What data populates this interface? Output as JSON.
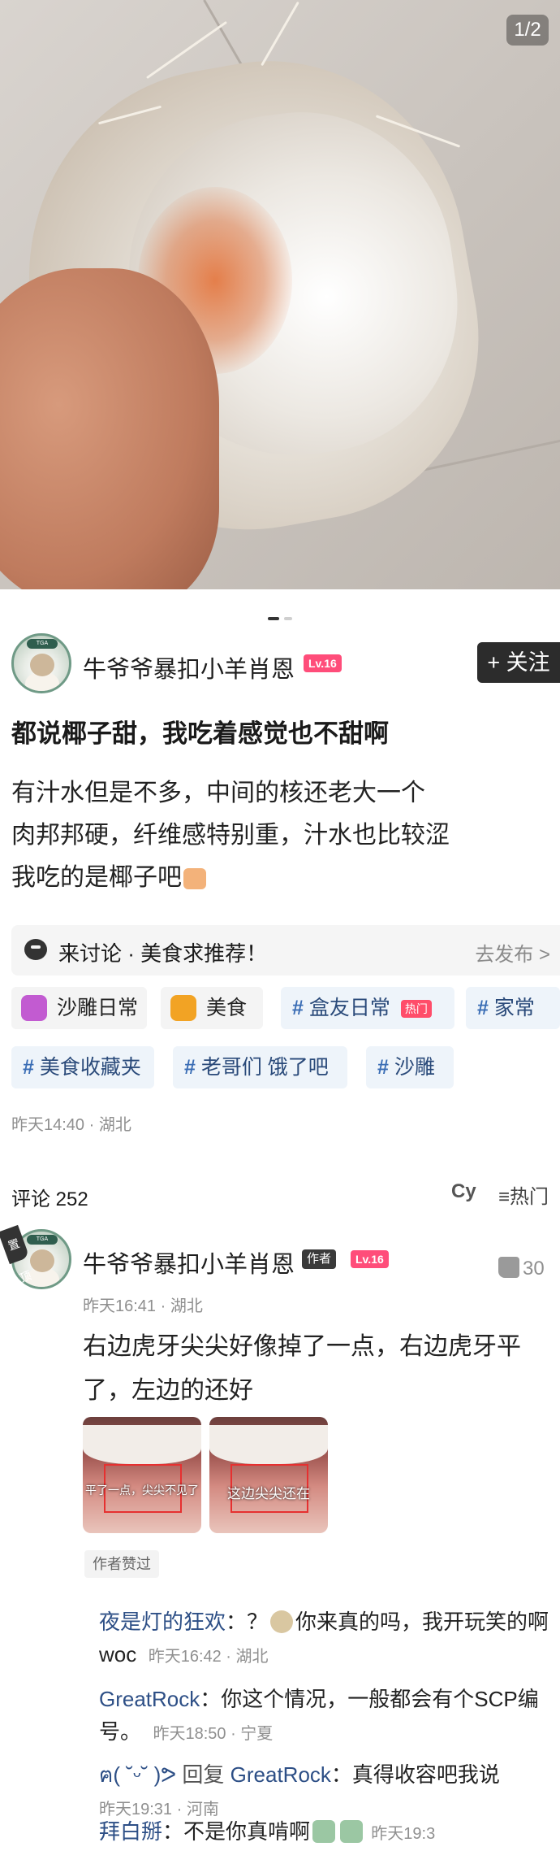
{
  "gallery": {
    "indicator": "1/2"
  },
  "post": {
    "author_name": "牛爷爷暴扣小羊肖恩",
    "level": "Lv.16",
    "follow_label": "+ 关注",
    "title": "都说椰子甜，我吃着感觉也不甜啊",
    "body_lines": [
      "有汁水但是不多，中间的核还老大一个",
      "肉邦邦硬，纤维感特别重，汁水也比较涩",
      "我吃的是椰子吧"
    ],
    "topic_text": "来讨论 · 美食求推荐！",
    "topic_action": "去发布 >",
    "tags": [
      {
        "label": "沙雕日常",
        "type": "circle"
      },
      {
        "label": "美食",
        "type": "circle"
      },
      {
        "label": "盒友日常",
        "type": "hashtag",
        "badge": "热门"
      },
      {
        "label": "家常",
        "type": "hashtag"
      },
      {
        "label": "美食收藏夹",
        "type": "hashtag"
      },
      {
        "label": "老哥们 饿了吧",
        "type": "hashtag"
      },
      {
        "label": "沙雕",
        "type": "hashtag"
      }
    ],
    "meta": "昨天14:40 · 湖北"
  },
  "comments_header": {
    "count_label": "评论 252",
    "cy_label": "Cy",
    "sort_label": "热门"
  },
  "top_comment": {
    "pin_label": "置顶",
    "author_name": "牛爷爷暴扣小羊肖恩",
    "author_badge": "作者",
    "level": "Lv.16",
    "like_count": "30",
    "meta": "昨天16:41 · 湖北",
    "body_line1": "右边虎牙尖尖好像掉了一点，右边虎牙平",
    "body_line2": "了，左边的还好",
    "image_captions": [
      "平了一点，尖尖不见了",
      "这边尖尖还在"
    ],
    "liked_by_author": "作者赞过"
  },
  "replies": [
    {
      "who": "夜是灯的狂欢",
      "text_a": "：？",
      "text_b": "你来真的吗，我开玩笑的啊",
      "text_c": "woc",
      "meta": "昨天16:42 · 湖北"
    },
    {
      "who": "GreatRock",
      "text_a": "：你这个情况，一般都会有个SCP编",
      "text_c": "号。",
      "meta": "昨天18:50 · 宁夏"
    },
    {
      "who": "ฅ( ˘ᵕ˘ )ᕗ",
      "prefix": "回复",
      "target": "GreatRock",
      "text_a": "：真得收容吧我说",
      "meta": "昨天19:31 · 河南"
    },
    {
      "who": "拜白掰",
      "text_a": "：不是你真啃啊",
      "meta": "昨天19:3"
    }
  ],
  "colors": {
    "accent_pink": "#ff4d7a",
    "link_blue": "#2d4f86",
    "follow_bg": "#2c2c2c"
  }
}
